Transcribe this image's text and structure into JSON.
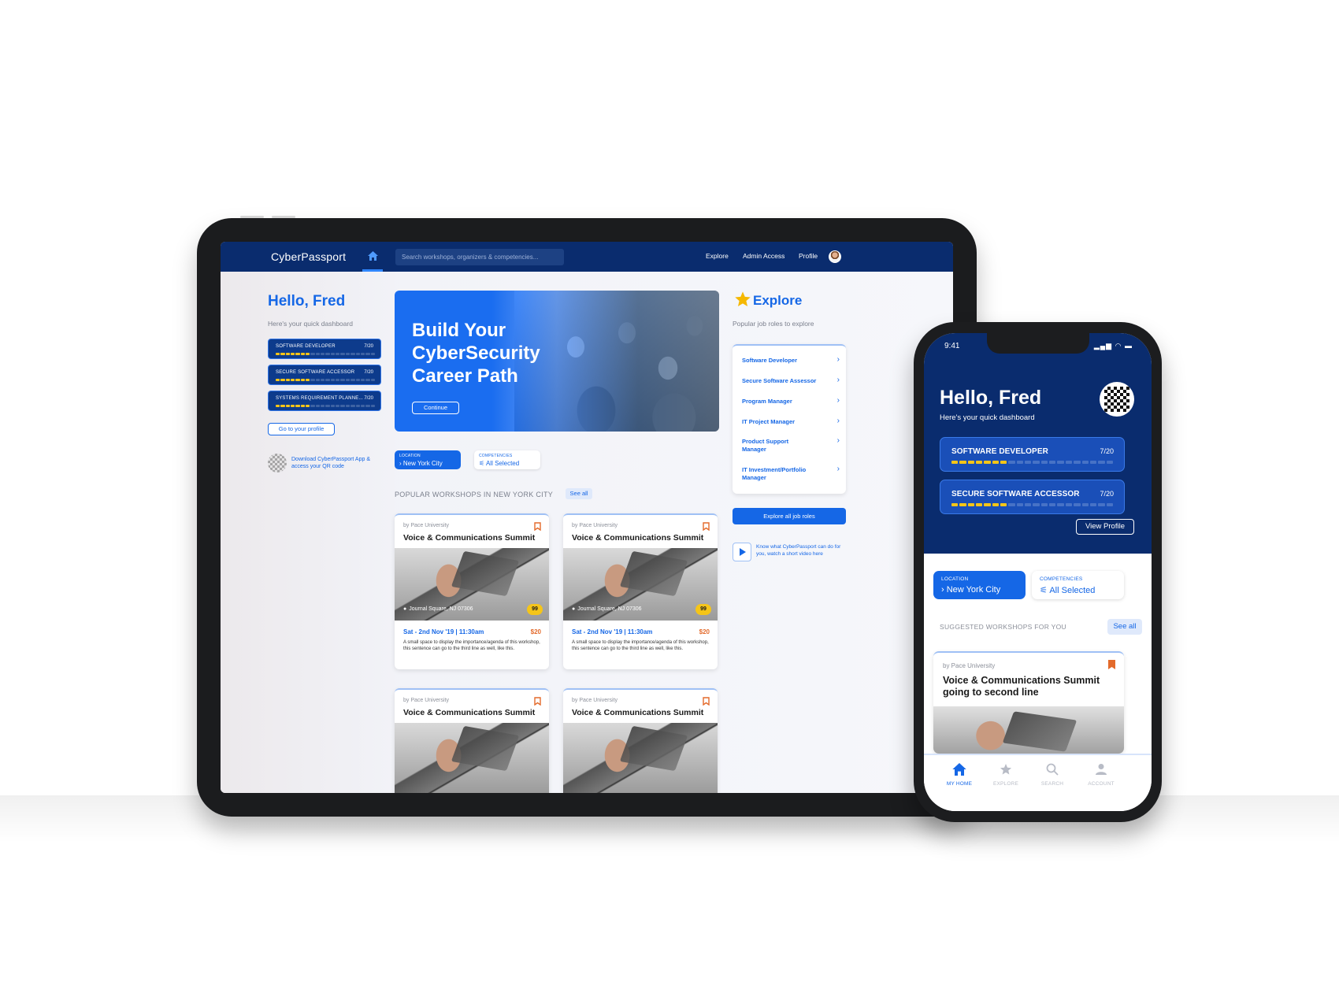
{
  "colors": {
    "primary": "#1567e6",
    "navy": "#0a2c6e",
    "accent_yellow": "#f5c518",
    "price_orange": "#e36a2b"
  },
  "tablet": {
    "header": {
      "logo": "CyberPassport",
      "search_placeholder": "Search workshops, organizers & competencies...",
      "nav": [
        "Explore",
        "Admin Access",
        "Profile"
      ]
    },
    "left": {
      "greeting": "Hello, Fred",
      "subtitle": "Here's your quick dashboard",
      "roles": [
        {
          "name": "SOFTWARE DEVELOPER",
          "score": "7/20",
          "progress": 7,
          "total": 20
        },
        {
          "name": "SECURE SOFTWARE ACCESSOR",
          "score": "7/20",
          "progress": 7,
          "total": 20
        },
        {
          "name": "SYSTEMS REQUIREMENT PLANNE...",
          "score": "7/20",
          "progress": 7,
          "total": 20
        }
      ],
      "profile_button": "Go to your profile",
      "download_text": "Download CyberPassport App & access your QR code"
    },
    "hero": {
      "title": "Build Your CyberSecurity Career Path",
      "button": "Continue"
    },
    "filters": {
      "location_label": "LOCATION",
      "location_value": "New York City",
      "competencies_label": "COMPETENCIES",
      "competencies_value": "All Selected"
    },
    "popular": {
      "heading": "POPULAR WORKSHOPS IN NEW YORK CITY",
      "see_all": "See all"
    },
    "workshops": [
      {
        "by": "by Pace University",
        "title": "Voice & Communications Summit",
        "address": "Journal Square, NJ 07306",
        "rating": "99",
        "date": "Sat - 2nd Nov '19 | 11:30am",
        "price": "$20",
        "description": "A small space to display the importance/agenda of this workshop, this sentence can go to the third line as well, like this."
      },
      {
        "by": "by Pace University",
        "title": "Voice & Communications Summit",
        "address": "Journal Square, NJ 07306",
        "rating": "99",
        "date": "Sat - 2nd Nov '19 | 11:30am",
        "price": "$20",
        "description": "A small space to display the importance/agenda of this workshop, this sentence can go to the third line as well, like this."
      },
      {
        "by": "by Pace University",
        "title": "Voice & Communications Summit"
      },
      {
        "by": "by Pace University",
        "title": "Voice & Communications Summit"
      }
    ],
    "explore": {
      "heading": "Explore",
      "subtitle": "Popular job roles to explore",
      "roles": [
        "Software Developer",
        "Secure Software Assessor",
        "Program Manager",
        "IT Project Manager",
        "Product Support Manager",
        "IT Investment/Portfolio Manager"
      ],
      "explore_all": "Explore all job roles",
      "video_text": "Know what CyberPassport can do for you, watch a short video here"
    }
  },
  "phone": {
    "status": {
      "time": "9:41"
    },
    "greeting": "Hello, Fred",
    "subtitle": "Here's your quick dashboard",
    "roles": [
      {
        "name": "SOFTWARE DEVELOPER",
        "score": "7/20",
        "progress": 7,
        "total": 20
      },
      {
        "name": "SECURE SOFTWARE ACCESSOR",
        "score": "7/20",
        "progress": 7,
        "total": 20
      }
    ],
    "view_profile": "View Profile",
    "filters": {
      "location_label": "LOCATION",
      "location_value": "New York City",
      "competencies_label": "COMPETENCIES",
      "competencies_value": "All Selected"
    },
    "suggested": {
      "heading": "SUGGESTED WORKSHOPS FOR YOU",
      "see_all": "See all"
    },
    "workshop": {
      "by": "by Pace University",
      "title": "Voice & Communications Summit going to second line"
    },
    "tabs": [
      "MY HOME",
      "EXPLORE",
      "SEARCH",
      "ACCOUNT"
    ]
  }
}
